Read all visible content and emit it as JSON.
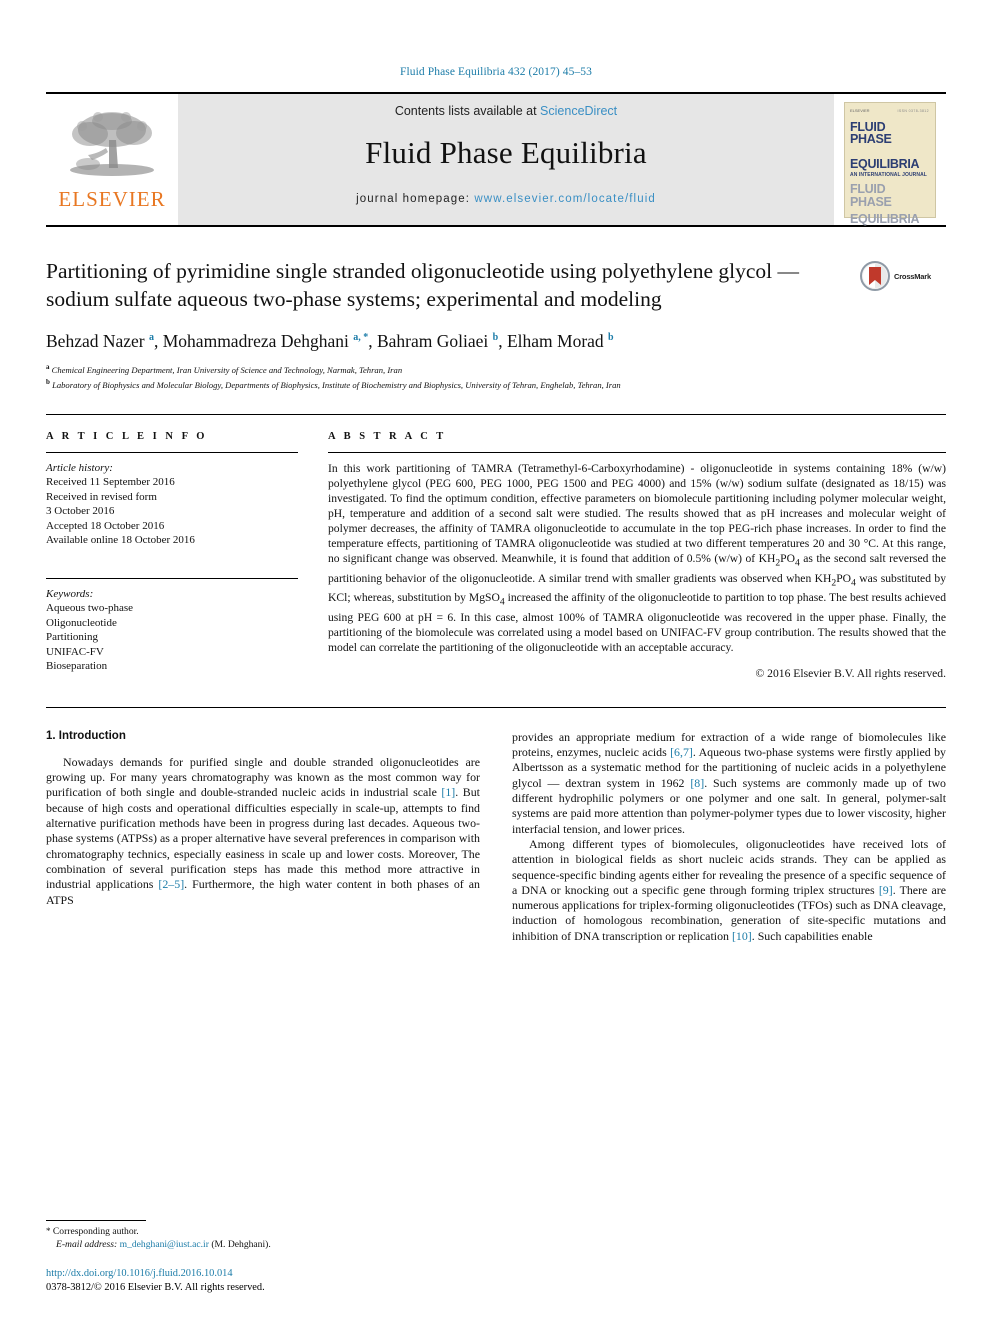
{
  "running_head": "Fluid Phase Equilibria 432 (2017) 45–53",
  "masthead": {
    "contents_prefix": "Contents lists available at ",
    "sciencedirect": "ScienceDirect",
    "journal_title": "Fluid Phase Equilibria",
    "homepage_prefix": "journal homepage: ",
    "homepage_url": "www.elsevier.com/locate/fluid",
    "publisher_logo_word": "ELSEVIER",
    "cover": {
      "line1": "FLUID PHASE",
      "line2": "EQUILIBRIA",
      "subtitle": "AN INTERNATIONAL JOURNAL",
      "line3": "FLUID PHASE",
      "line4": "EQUILIBRIA",
      "top_left": "ELSEVIER",
      "top_right": "ISSN 0378-3812"
    },
    "link_color": "#3a8fc4"
  },
  "article": {
    "title": "Partitioning of pyrimidine single stranded oligonucleotide using polyethylene glycol — sodium sulfate aqueous two-phase systems; experimental and modeling",
    "crossmark_label": "CrossMark",
    "authors_html": "Behzad Nazer <sup>a</sup>, Mohammadreza Dehghani <sup>a, *</sup>, Bahram Goliaei <sup>b</sup>, Elham Morad <sup>b</sup>",
    "affiliation_a": "Chemical Engineering Department, Iran University of Science and Technology, Narmak, Tehran, Iran",
    "affiliation_b": "Laboratory of Biophysics and Molecular Biology, Departments of Biophysics, Institute of Biochemistry and Biophysics, University of Tehran, Enghelab, Tehran, Iran"
  },
  "article_info": {
    "heading": "A R T I C L E   I N F O",
    "history_label": "Article history:",
    "history": [
      "Received 11 September 2016",
      "Received in revised form",
      "3 October 2016",
      "Accepted 18 October 2016",
      "Available online 18 October 2016"
    ],
    "keywords_label": "Keywords:",
    "keywords": [
      "Aqueous two-phase",
      "Oligonucleotide",
      "Partitioning",
      "UNIFAC-FV",
      "Bioseparation"
    ]
  },
  "abstract": {
    "heading": "A B S T R A C T",
    "text": "In this work partitioning of TAMRA (Tetramethyl-6-Carboxyrhodamine) - oligonucleotide in systems containing 18% (w/w) polyethylene glycol (PEG 600, PEG 1000, PEG 1500 and PEG 4000) and 15% (w/w) sodium sulfate (designated as 18/15) was investigated. To find the optimum condition, effective parameters on biomolecule partitioning including polymer molecular weight, pH, temperature and addition of a second salt were studied. The results showed that as pH increases and molecular weight of polymer decreases, the affinity of TAMRA oligonucleotide to accumulate in the top PEG-rich phase increases. In order to find the temperature effects, partitioning of TAMRA oligonucleotide was studied at two different temperatures 20 and 30 °C. At this range, no significant change was observed. Meanwhile, it is found that addition of 0.5% (w/w) of KH2PO4 as the second salt reversed the partitioning behavior of the oligonucleotide. A similar trend with smaller gradients was observed when KH2PO4 was substituted by KCl; whereas, substitution by MgSO4 increased the affinity of the oligonucleotide to partition to top phase. The best results achieved using PEG 600 at pH = 6. In this case, almost 100% of TAMRA oligonucleotide was recovered in the upper phase. Finally, the partitioning of the biomolecule was correlated using a model based on UNIFAC-FV group contribution. The results showed that the model can correlate the partitioning of the oligonucleotide with an acceptable accuracy.",
    "copyright": "© 2016 Elsevier B.V. All rights reserved."
  },
  "introduction": {
    "heading": "1.  Introduction",
    "left_paragraph_1": "Nowadays demands for purified single and double stranded oligonucleotides are growing up. For many years chromatography was known as the most common way for purification of both single and double-stranded nucleic acids in industrial scale [1]. But because of high costs and operational difficulties especially in scale-up, attempts to find alternative purification methods have been in progress during last decades. Aqueous two-phase systems (ATPSs) as a proper alternative have several preferences in comparison with chromatography technics, especially easiness in scale up and lower costs. Moreover, The combination of several purification steps has made this method more attractive in industrial applications [2–5]. Furthermore, the high water content in both phases of an ATPS",
    "right_paragraph_1": "provides an appropriate medium for extraction of a wide range of biomolecules like proteins, enzymes, nucleic acids [6,7]. Aqueous two-phase systems were firstly applied by Albertsson as a systematic method for the partitioning of nucleic acids in a polyethylene glycol — dextran system in 1962 [8]. Such systems are commonly made up of two different hydrophilic polymers or one polymer and one salt. In general, polymer-salt systems are paid more attention than polymer-polymer types due to lower viscosity, higher interfacial tension, and lower prices.",
    "right_paragraph_2": "Among different types of biomolecules, oligonucleotides have received lots of attention in biological fields as short nucleic acids strands. They can be applied as sequence-specific binding agents either for revealing the presence of a specific sequence of a DNA or knocking out a specific gene through forming triplex structures [9]. There are numerous applications for triplex-forming oligonucleotides (TFOs) such as DNA cleavage, induction of homologous recombination, generation of site-specific mutations and inhibition of DNA transcription or replication [10]. Such capabilities enable"
  },
  "footer": {
    "corresponding_author": "Corresponding author.",
    "email_label": "E-mail address:",
    "email": "m_dehghani@iust.ac.ir",
    "email_suffix": "(M. Dehghani).",
    "doi": "http://dx.doi.org/10.1016/j.fluid.2016.10.014",
    "issn_line": "0378-3812/© 2016 Elsevier B.V. All rights reserved."
  }
}
